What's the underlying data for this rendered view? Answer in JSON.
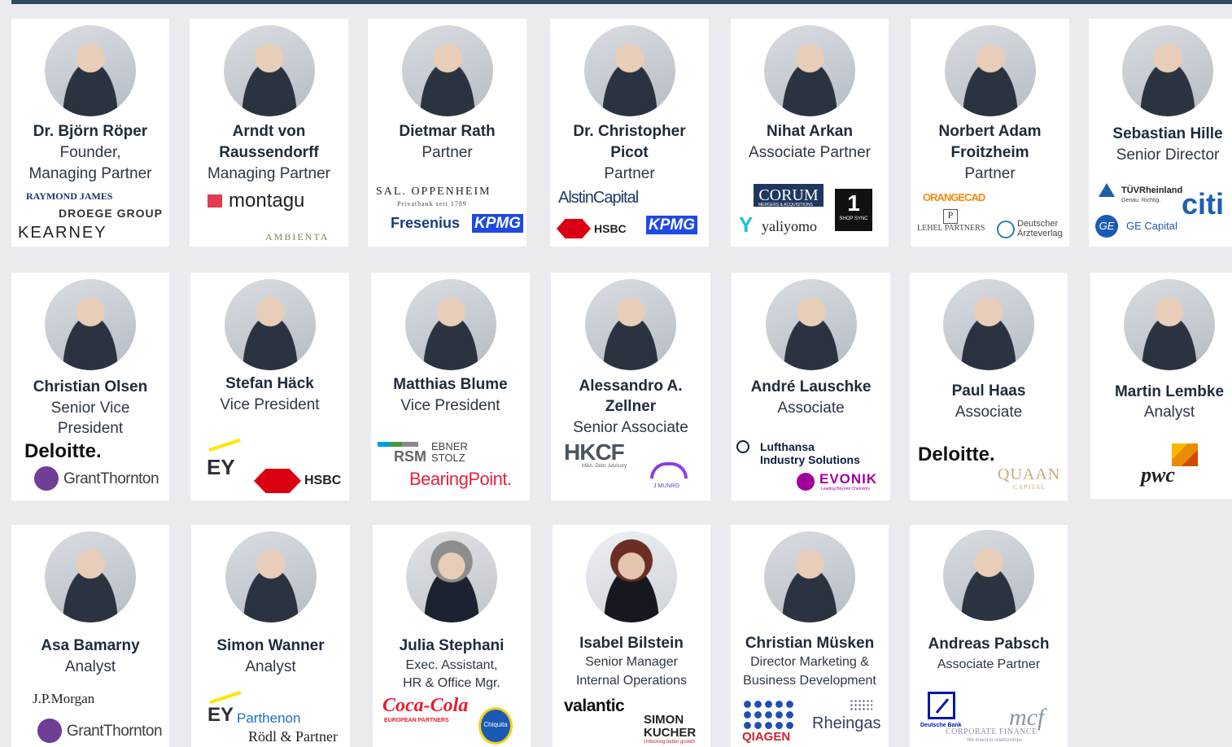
{
  "people": {
    "roeper": {
      "name": "Dr. Björn Röper",
      "role1": "Founder,",
      "role2": "Managing Partner"
    },
    "raussendorff": {
      "name1": "Arndt von",
      "name2": "Raussendorff",
      "role": "Managing Partner"
    },
    "rath": {
      "name": "Dietmar Rath",
      "role": "Partner"
    },
    "picot": {
      "name1": "Dr. Christopher",
      "name2": "Picot",
      "role": "Partner"
    },
    "arkan": {
      "name": "Nihat Arkan",
      "role": "Associate Partner"
    },
    "froitzheim": {
      "name1": "Norbert Adam",
      "name2": "Froitzheim",
      "role": "Partner"
    },
    "hille": {
      "name": "Sebastian Hille",
      "role": "Senior Director"
    },
    "olsen": {
      "name": "Christian Olsen",
      "role1": "Senior Vice",
      "role2": "President"
    },
    "haeck": {
      "name": "Stefan Häck",
      "role": "Vice President"
    },
    "blume": {
      "name": "Matthias Blume",
      "role": "Vice President"
    },
    "zellner": {
      "name1": "Alessandro A.",
      "name2": "Zellner",
      "role": "Senior Associate"
    },
    "lauschke": {
      "name": "André Lauschke",
      "role": "Associate"
    },
    "haas": {
      "name": "Paul Haas",
      "role": "Associate"
    },
    "lembke": {
      "name": "Martin Lembke",
      "role": "Analyst"
    },
    "bamarny": {
      "name": "Asa Bamarny",
      "role": "Analyst"
    },
    "wanner": {
      "name": "Simon Wanner",
      "role": "Analyst"
    },
    "stephani": {
      "name": "Julia Stephani",
      "role1": "Exec. Assistant,",
      "role2": "HR & Office Mgr."
    },
    "bilstein": {
      "name": "Isabel Bilstein",
      "role1": "Senior Manager",
      "role2": "Internal Operations"
    },
    "muesken": {
      "name": "Christian Müsken",
      "role1": "Director Marketing &",
      "role2": "Business Development"
    },
    "pabsch": {
      "name": "Andreas Pabsch",
      "role": "Associate Partner"
    }
  },
  "logos": {
    "raymond_james": "RAYMOND JAMES",
    "droege": "DROEGE GROUP",
    "kearney": "KEARNEY",
    "montagu": "montagu",
    "ambienta": "AMBIENTA",
    "sal_oppenheim": "SAL. OPPENHEIM",
    "sal_oppenheim_sub": "Privatbank seit 1789",
    "fresenius": "Fresenius",
    "kpmg": "KPMG",
    "alstin": "AlstinCapital",
    "hsbc": "HSBC",
    "corum": "CORUM",
    "corum_sub": "MERGERS & ACQUISITIONS",
    "yaliyomo": "yaliyomo",
    "one_sync": "1",
    "one_sync_sub": "SHOP SYNC",
    "orangecad": "ORANGECAD",
    "lehel": "LEHEL PARTNERS",
    "aerzteverlag1": "Deutscher",
    "aerzteverlag2": "Ärzteverlag",
    "tuv": "TÜVRheinland",
    "tuv_sub": "Genau. Richtig.",
    "citi": "citi",
    "ge_capital": "GE Capital",
    "deloitte": "Deloitte.",
    "grant_thornton": "GrantThornton",
    "ey": "EY",
    "rsm": "RSM",
    "ebner": "EBNER",
    "stolz": "STOLZ",
    "bearingpoint": "BearingPoint.",
    "hkcf": "HKCF",
    "hkcf_sub": "M&A. Debt. Advisory",
    "jmunro": "J MUNRO",
    "lufthansa1": "Lufthansa",
    "lufthansa2": "Industry Solutions",
    "evonik": "EVONIK",
    "evonik_sub": "Leading Beyond Chemistry",
    "quaan": "QUAAN",
    "quaan_sub": "CAPITAL",
    "pwc": "pwc",
    "jpmorgan": "J.P.Morgan",
    "parthenon": "Parthenon",
    "roedl": "Rödl & Partner",
    "cocacola": "Coca-Cola",
    "cocacola_sub": "EUROPEAN PARTNERS",
    "chiquita": "Chiquita",
    "valantic": "valantic",
    "simon_kucher1": "SIMON",
    "simon_kucher2": "KUCHER",
    "simon_kucher_sub": "Unlocking better growth",
    "qiagen": "QIAGEN",
    "rheingas": "Rheingas",
    "deutsche_bank": "Deutsche Bank",
    "mcf": "mcf",
    "mcf_sub1": "CORPORATE FINANCE",
    "mcf_sub2": "We invest in relationships"
  },
  "colors": {
    "top_line": "#2e4a5c",
    "background": "#e9ebee",
    "card": "#ffffff",
    "name_text": "#1e2b39"
  }
}
